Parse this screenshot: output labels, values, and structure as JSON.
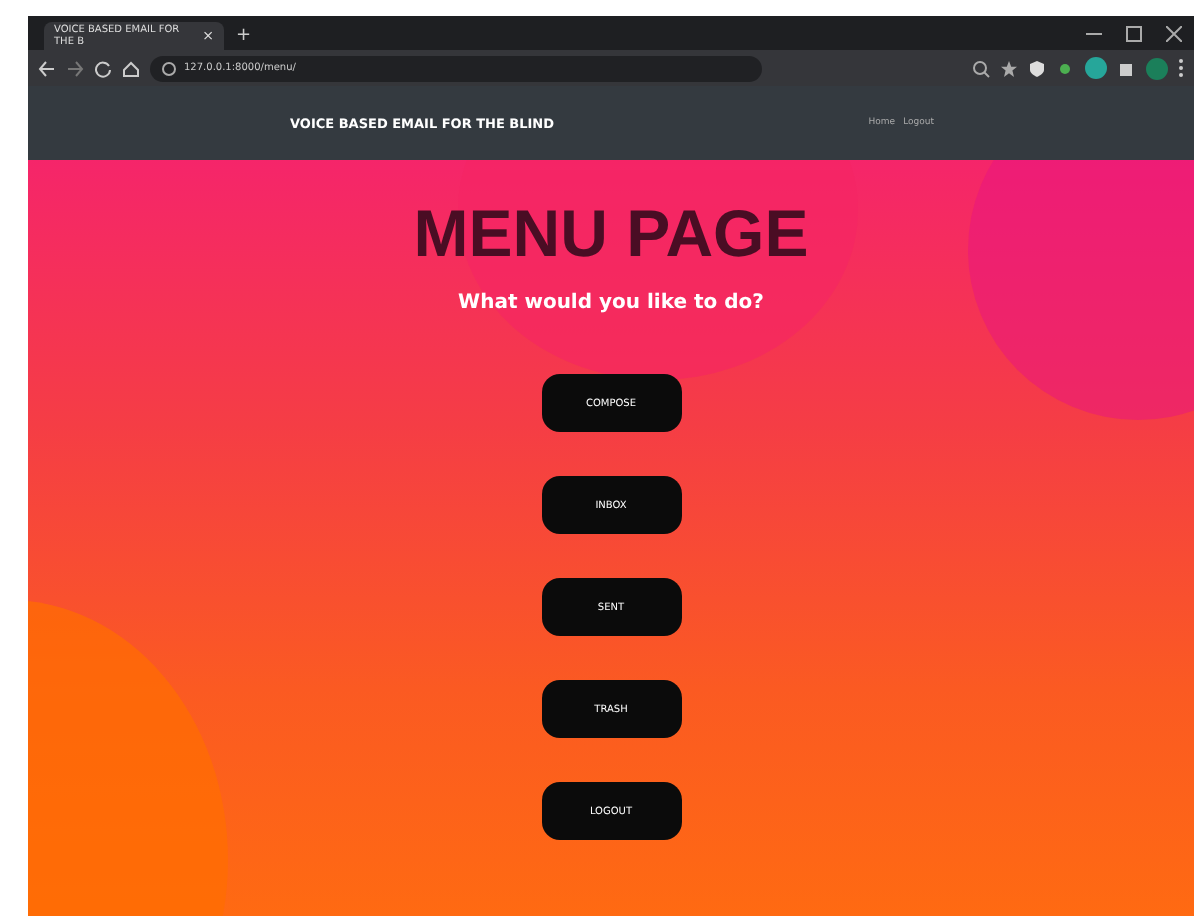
{
  "browser": {
    "tab_title": "VOICE BASED EMAIL FOR THE B",
    "tab_close": "×",
    "new_tab": "+",
    "address": "127.0.0.1:8000/menu/"
  },
  "navbar": {
    "brand": "VOICE BASED EMAIL FOR THE BLIND",
    "links": [
      "Home",
      "Logout"
    ]
  },
  "page": {
    "title": "MENU PAGE",
    "subtitle": "What would you like to do?",
    "buttons": [
      "COMPOSE",
      "INBOX",
      "SENT",
      "TRASH",
      "LOGOUT"
    ]
  }
}
